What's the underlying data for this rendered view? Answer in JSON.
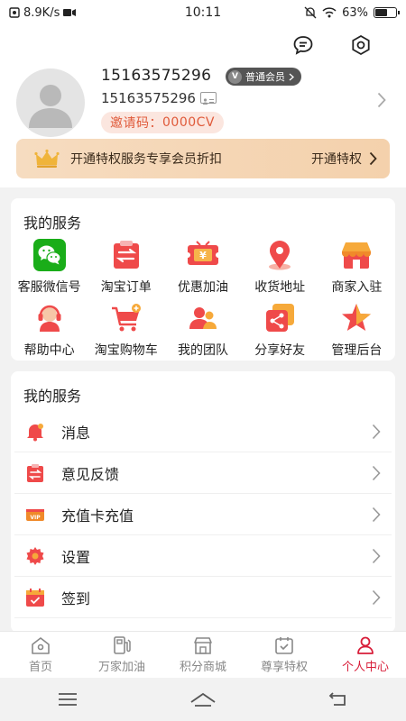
{
  "status": {
    "speed": "8.9K/s",
    "time": "10:11",
    "battery": "63%",
    "battery_level": 63
  },
  "profile": {
    "name": "15163575296",
    "member_level": "普通会员",
    "phone": "15163575296",
    "invite_label": "邀请码：",
    "invite_code": "0000CV"
  },
  "vip_banner": {
    "text": "开通特权服务专享会员折扣",
    "action": "开通特权"
  },
  "services": {
    "title": "我的服务",
    "items": [
      {
        "label": "客服微信号",
        "icon": "wechat-icon"
      },
      {
        "label": "淘宝订单",
        "icon": "order-icon"
      },
      {
        "label": "优惠加油",
        "icon": "coupon-icon"
      },
      {
        "label": "收货地址",
        "icon": "location-icon"
      },
      {
        "label": "商家入驻",
        "icon": "shop-icon"
      },
      {
        "label": "帮助中心",
        "icon": "headset-icon"
      },
      {
        "label": "淘宝购物车",
        "icon": "cart-icon"
      },
      {
        "label": "我的团队",
        "icon": "team-icon"
      },
      {
        "label": "分享好友",
        "icon": "share-icon"
      },
      {
        "label": "管理后台",
        "icon": "star-icon"
      }
    ]
  },
  "menu": {
    "title": "我的服务",
    "items": [
      {
        "label": "消息",
        "icon": "bell-icon"
      },
      {
        "label": "意见反馈",
        "icon": "feedback-icon"
      },
      {
        "label": "充值卡充值",
        "icon": "vip-card-icon"
      },
      {
        "label": "设置",
        "icon": "gear-icon"
      },
      {
        "label": "签到",
        "icon": "calendar-check-icon"
      }
    ]
  },
  "tabs": [
    {
      "label": "首页",
      "icon": "home-icon",
      "active": false
    },
    {
      "label": "万家加油",
      "icon": "fuel-icon",
      "active": false
    },
    {
      "label": "积分商城",
      "icon": "store-icon",
      "active": false
    },
    {
      "label": "尊享特权",
      "icon": "privilege-icon",
      "active": false
    },
    {
      "label": "个人中心",
      "icon": "person-icon",
      "active": true
    }
  ],
  "colors": {
    "accent": "#d81e3a",
    "invite": "#e05a3a",
    "banner": "#f4d1ac"
  }
}
